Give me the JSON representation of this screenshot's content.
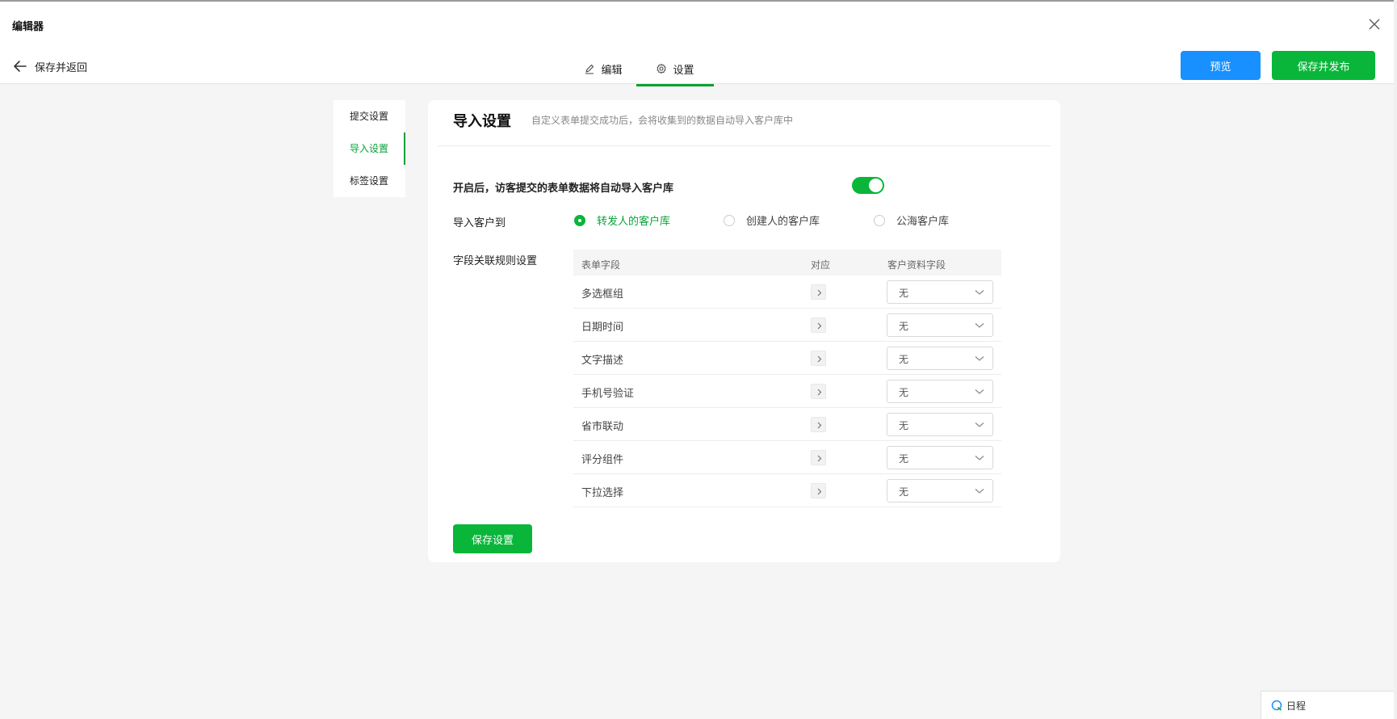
{
  "window": {
    "title": "编辑器"
  },
  "header": {
    "back_label": "保存并返回",
    "tabs": [
      {
        "label": "编辑",
        "icon": "pen-icon",
        "active": false
      },
      {
        "label": "设置",
        "icon": "gear-icon",
        "active": true
      }
    ],
    "preview_label": "预览",
    "publish_label": "保存并发布"
  },
  "sidebar": {
    "items": [
      {
        "label": "提交设置",
        "active": false
      },
      {
        "label": "导入设置",
        "active": true
      },
      {
        "label": "标签设置",
        "active": false
      }
    ]
  },
  "panel": {
    "title": "导入设置",
    "description": "自定义表单提交成功后，会将收集到的数据自动导入客户库中",
    "toggle_label": "开启后，访客提交的表单数据将自动导入客户库",
    "toggle_on": true,
    "import_to_label": "导入客户到",
    "radio_options": [
      {
        "label": "转发人的客户库",
        "checked": true
      },
      {
        "label": "创建人的客户库",
        "checked": false
      },
      {
        "label": "公海客户库",
        "checked": false
      }
    ],
    "rules_label": "字段关联规则设置",
    "table": {
      "headers": [
        "表单字段",
        "对应",
        "客户资料字段"
      ],
      "rows": [
        {
          "field": "多选框组",
          "value": "无"
        },
        {
          "field": "日期时间",
          "value": "无"
        },
        {
          "field": "文字描述",
          "value": "无"
        },
        {
          "field": "手机号验证",
          "value": "无"
        },
        {
          "field": "省市联动",
          "value": "无"
        },
        {
          "field": "评分组件",
          "value": "无"
        },
        {
          "field": "下拉选择",
          "value": "无"
        }
      ]
    },
    "save_label": "保存设置"
  },
  "schedule": {
    "label": "日程",
    "icon": "schedule-icon"
  },
  "colors": {
    "accent_green": "#09b63a",
    "preview_blue": "#1890ff"
  }
}
